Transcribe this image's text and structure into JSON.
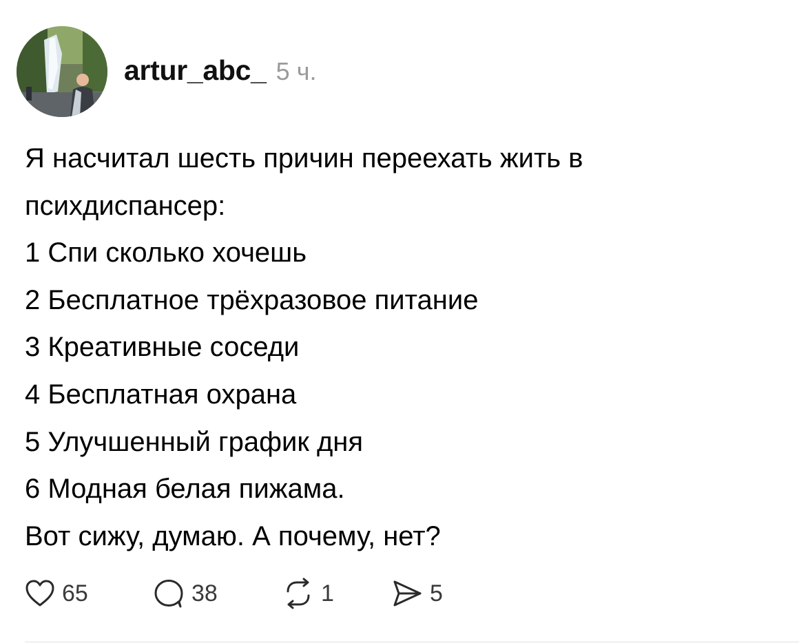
{
  "post": {
    "username": "artur_abc_",
    "timestamp": "5 ч.",
    "lines": [
      "Я насчитал шесть причин переехать жить в",
      "психдиспансер:",
      "1 Спи сколько хочешь",
      "2 Бесплатное трёхразовое питание",
      "3 Креативные соседи",
      "4 Бесплатная охрана",
      "5 Улучшенный график дня",
      "6 Модная белая пижама.",
      "Вот сижу, думаю. А почему, нет?"
    ],
    "actions": {
      "likes": "65",
      "replies": "38",
      "reposts": "1",
      "shares": "5"
    }
  },
  "colors": {
    "text": "#000000",
    "username": "#111111",
    "muted": "#9a9a9a",
    "icon": "#2a2a2a",
    "divider": "#e2e2e2"
  },
  "icons": {
    "like": "heart-icon",
    "reply": "speech-bubble-icon",
    "repost": "repost-arrows-icon",
    "share": "paper-plane-icon"
  }
}
